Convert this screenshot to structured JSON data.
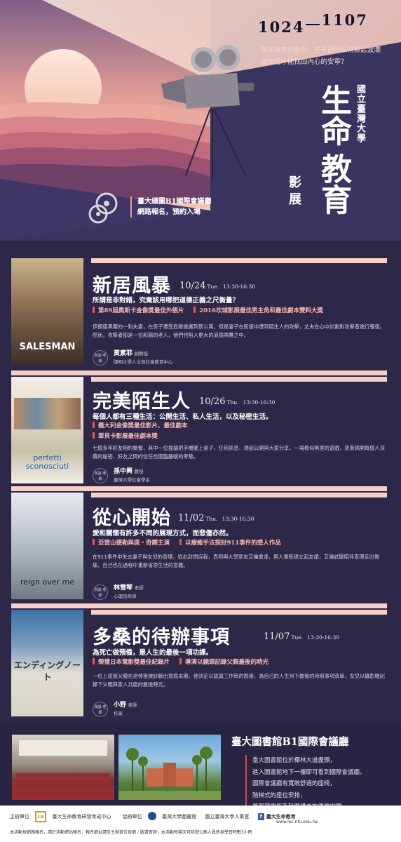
{
  "hero": {
    "date_start": "1024",
    "date_end": "1107",
    "tagline_1": "突如其來的意外，在平靜的日常掀起波瀾",
    "tagline_2": "該如何才能找回內心的安寧？",
    "university": "國立臺灣大學",
    "title_1": "生命",
    "title_2": "教育",
    "subtitle": "影展",
    "venue_line_1": "臺大總圖B1國際會議廳",
    "venue_line_2": "網路報名，預約入場"
  },
  "films": [
    {
      "title": "新居風暴",
      "date": "10/24",
      "day": "Tue.",
      "time": "13:30-16:30",
      "tagline": "所謂是非對錯，究竟該用哪把道德正義之尺衡量？",
      "awards": [
        "第89屆奧斯卡金像獎最佳外語片",
        "2016坎城影展最佳男主角和最佳劇本雙料大獎"
      ],
      "desc": "伊朗德黑蘭的一對夫妻，在房子遭受危險後搬到新公寓，但是妻子在新居中遭到陌生人的攻擊，丈夫在心中計劃對攻擊者進行報復。然而，攻擊者卻是一位和藹的老人，他們也陷入更大的道德兩難之中。",
      "speaker_badge": "與談 老師",
      "speaker_name": "黃素菲",
      "speaker_role": "副教授",
      "speaker_aff": "陽明大學人文與社會教育中心",
      "poster_top": "#c9b48a",
      "poster_bottom": "#3a2e28",
      "poster_text": "SALESMAN"
    },
    {
      "title": "完美陌生人",
      "date": "10/26",
      "day": "Thu.",
      "time": "13:30-16:30",
      "tagline": "每個人都有三種生活：公開生活、私人生活，以及秘密生活。",
      "awards": [
        "義大利金像獎最佳影片、最佳劇本",
        "翠貝卡影展最佳劇本獎"
      ],
      "desc": "七個多年好友相約聚餐，其中一位提議把手機擺上桌子，任何訊息、通話公開與大家分享，一場看似無害的遊戲，逐漸揭開每個人深藏的秘密，好友之間的信任也面臨嚴峻的考驗。",
      "speaker_badge": "與談 老師",
      "speaker_name": "孫中興",
      "speaker_role": "教授",
      "speaker_aff": "臺灣大學社會學系",
      "poster_top": "#f0ede2",
      "poster_bottom": "#d6d2c4",
      "poster_text": "perfetti sconosciuti"
    },
    {
      "title": "從心開始",
      "date": "11/02",
      "day": "Thu.",
      "time": "13:30-16:30",
      "tagline": "愛和關懷有許多不同的展現方式，而悲傷亦然。",
      "awards": [
        "亞當山德勒與唐‧奇鐸主演",
        "以療癒手法探討911事件的感人作品"
      ],
      "desc": "在911事件中失去妻子與女兒的查理，從此封閉自我，直到與大學室友艾倫重逢，兩人重新建立起友誼，艾倫試圖陪伴查理走出傷痛，自己也在過程中重新省思生活的意義。",
      "speaker_badge": "與談 老師",
      "speaker_name": "林雪琴",
      "speaker_role": "老師",
      "speaker_aff": "心理諮商師",
      "poster_top": "#e6ebf0",
      "poster_bottom": "#8a99a6",
      "poster_text": "reign over me"
    },
    {
      "title": "多桑的待辦事項",
      "date": "11/07",
      "day": "Tue.",
      "time": "13:30-16:30",
      "tagline": "為死亡做預備，是人生的最後一項功課。",
      "awards": [
        "榮獲日本電影獎最佳紀錄片",
        "導演以鏡頭記錄父親最後的時光"
      ],
      "desc": "一位上班族父親在退休後被診斷出胃癌末期，他決定以認真工作時的態度，為自己的人生列下最後的待辦事項清單，女兒以攝影機記錄下父親與家人共度的最後時光。",
      "speaker_badge": "與談 老師",
      "speaker_name": "小野",
      "speaker_role": "老師",
      "speaker_aff": "作家",
      "poster_top": "#3c6fa8",
      "poster_bottom": "#d9d4c8",
      "poster_text": "エンディングノート"
    }
  ],
  "venue": {
    "title": "臺大圖書館B1國際會議廳",
    "lines": [
      "臺大圖書館位於椰林大道盡頭，",
      "進入圖書館地下一樓即可看到國際會議廳。",
      "國際會議廳有寬敞舒適的座椅，",
      "階梯式的座位安排，",
      "是觀賞電影及聆聽講者的優質空間。"
    ]
  },
  "footer": {
    "host_label": "主辦單位",
    "co_label": "協辦單位",
    "orgs": [
      "臺大生命教育研發育成中心",
      "臺灣大學圖書館",
      "國立臺灣大學人事室"
    ],
    "fb_label": "f",
    "fb_name": "臺大生命教育",
    "site": "www.lec.ntu.edu.tw",
    "note": "本活動採網路報名，請於活動網站報名；報名網址請至主辦單位官網 / 臉書查詢；本活動每場次可核發公務人員終身學習時數3小時"
  }
}
